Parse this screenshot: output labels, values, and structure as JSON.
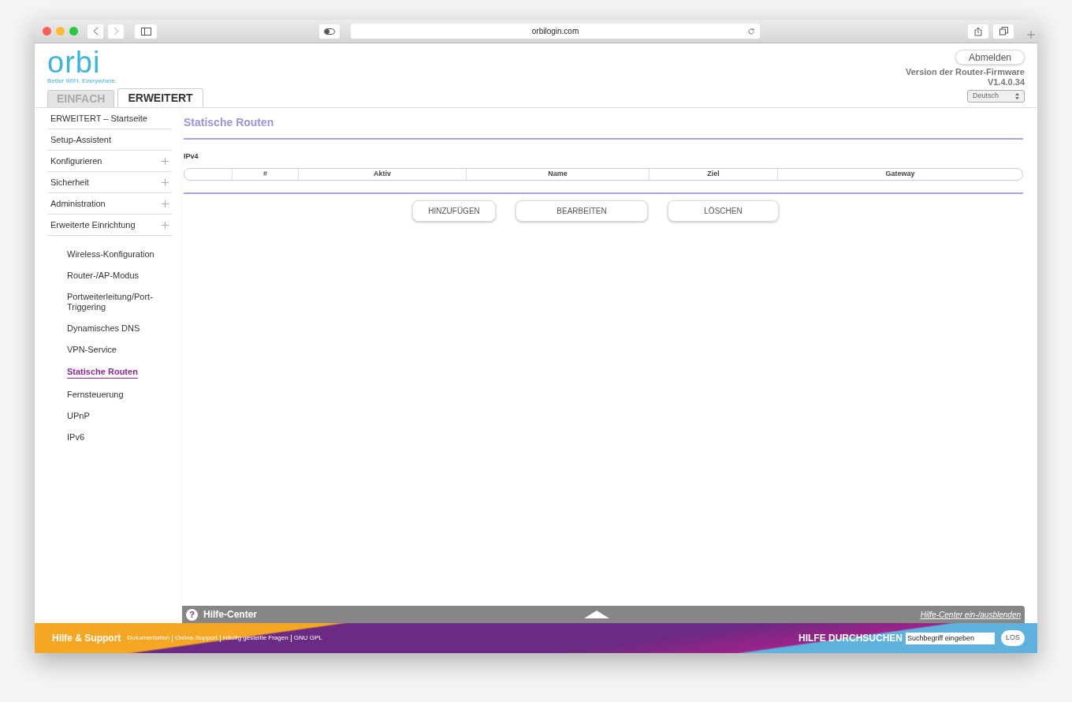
{
  "browser": {
    "url": "orbilogin.com"
  },
  "header": {
    "logo": "orbi",
    "tagline": "Better WiFi. Everywhere.",
    "tabs": [
      {
        "label": "EINFACH",
        "selected": false
      },
      {
        "label": "ERWEITERT",
        "selected": true
      }
    ],
    "logout_button": "Abmelden",
    "firmware_label": "Version der Router-Firmware",
    "firmware_version": "V1.4.0.34",
    "language": "Deutsch"
  },
  "sidebar": {
    "items": [
      {
        "label": "ERWEITERT – Startseite",
        "has_submenu": false
      },
      {
        "label": "Setup-Assistent",
        "has_submenu": false
      },
      {
        "label": "Konfigurieren",
        "has_submenu": true
      },
      {
        "label": "Sicherheit",
        "has_submenu": true
      },
      {
        "label": "Administration",
        "has_submenu": true
      },
      {
        "label": "Erweiterte Einrichtung",
        "has_submenu": true,
        "children": [
          {
            "label": "Wireless-Konfiguration",
            "selected": false
          },
          {
            "label": "Router-/AP-Modus",
            "selected": false
          },
          {
            "label": "Portweiterleitung/Port-Triggering",
            "selected": false
          },
          {
            "label": "Dynamisches DNS",
            "selected": false
          },
          {
            "label": "VPN-Service",
            "selected": false
          },
          {
            "label": "Statische Routen",
            "selected": true
          },
          {
            "label": "Fernsteuerung",
            "selected": false
          },
          {
            "label": "UPnP",
            "selected": false
          },
          {
            "label": "IPv6",
            "selected": false
          }
        ]
      }
    ]
  },
  "page_title": "Statische Routen",
  "section": "IPv4",
  "table": {
    "columns": [
      "#",
      "Aktiv",
      "Name",
      "Ziel",
      "Gateway"
    ]
  },
  "buttons": [
    "HINZUFÜGEN",
    "BEARBEITEN",
    "LÖSCHEN"
  ],
  "help_bar": {
    "icon": "?",
    "title": "Hilfe-Center",
    "toggle_link": "Hilfe-Center ein-/ausblenden"
  },
  "footer": {
    "title": "Hilfe & Support",
    "links": [
      "Dokumentation",
      "Online-Support",
      "Häufig gestellte Fragen",
      "GNU GPL"
    ],
    "search_label": "HILFE DURCHSUCHEN",
    "search_placeholder": "Suchbegriff eingeben",
    "go_button": "LOS"
  }
}
